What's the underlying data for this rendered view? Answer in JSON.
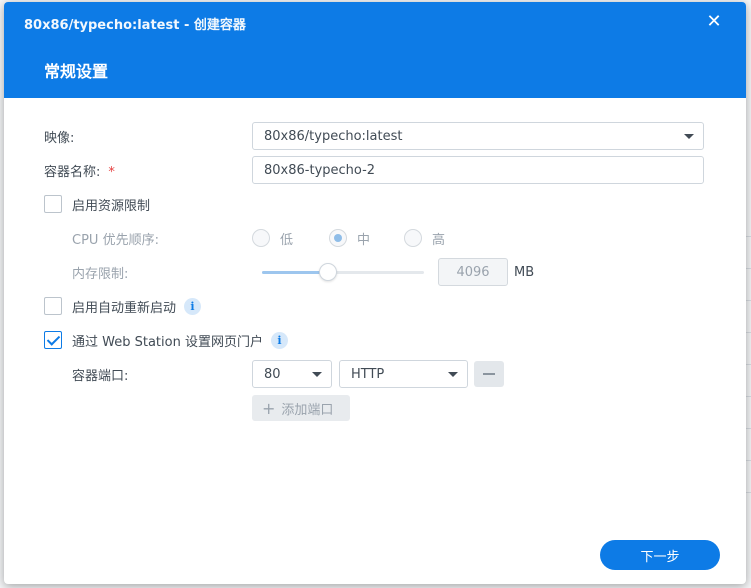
{
  "window": {
    "title": "80x86/typecho:latest - 创建容器",
    "section_title": "常规设置",
    "close_glyph": "✕"
  },
  "form": {
    "image_label": "映像:",
    "image_value": "80x86/typecho:latest",
    "name_label": "容器名称:",
    "name_required": "*",
    "name_value": "80x86-typecho-2",
    "resource_limit_label": "启用资源限制",
    "resource_limit_checked": false,
    "cpu_priority_label": "CPU 优先顺序:",
    "cpu_options": [
      "低",
      "中",
      "高"
    ],
    "cpu_selected": "中",
    "memory_label": "内存限制:",
    "memory_value": "4096",
    "memory_unit": "MB",
    "memory_slider_fraction": 0.41,
    "auto_restart_label": "启用自动重新启动",
    "auto_restart_checked": false,
    "web_station_label": "通过 Web Station 设置网页门户",
    "web_station_checked": true,
    "port_label": "容器端口:",
    "port_value": "80",
    "protocol_value": "HTTP",
    "add_port_label": "添加端口",
    "info_glyph": "i"
  },
  "footer": {
    "next_label": "下一步"
  },
  "colors": {
    "accent": "#0d7be6",
    "required": "#e64040"
  }
}
